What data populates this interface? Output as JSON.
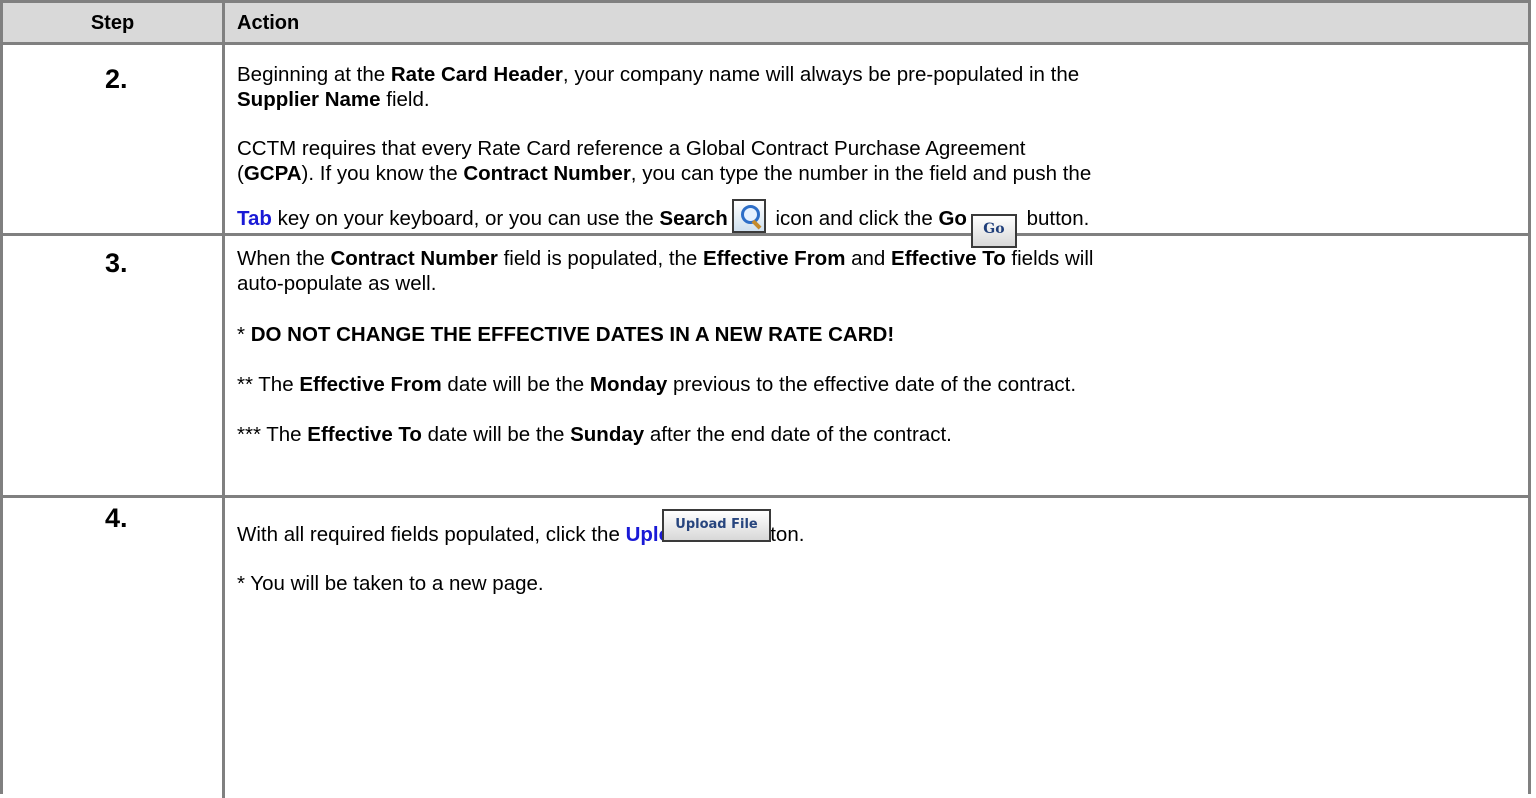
{
  "header": {
    "step": "Step",
    "action": "Action"
  },
  "rows": [
    {
      "step": "2.",
      "lines": {
        "l1a": "Beginning at the ",
        "l1b": "Rate Card Header",
        "l1c": ", your company name will always be pre-populated in the",
        "l2a": "Supplier Name",
        "l2b": " field.",
        "l3": "CCTM requires that every Rate Card reference a Global Contract Purchase Agreement",
        "l4a": "(",
        "l4b": "GCPA",
        "l4c": ").  If you know the ",
        "l4d": "Contract Number",
        "l4e": ", you can type the number in the field and push the",
        "l5a": "Tab",
        "l5b": " key on your keyboard, or you can use the ",
        "l5c": "Search",
        "l5d": " icon and click the ",
        "l5e": "Go",
        "l5f": " button."
      },
      "go_label": "Go"
    },
    {
      "step": "3.",
      "lines": {
        "l1a": "When the ",
        "l1b": "Contract Number",
        "l1c": " field is populated, the ",
        "l1d": "Effective From",
        "l1e": " and ",
        "l1f": "Effective To",
        "l1g": " fields will",
        "l2": "auto-populate as well.",
        "l3a": "* ",
        "l3b": "DO NOT CHANGE THE EFFECTIVE DATES IN A NEW RATE CARD!",
        "l4a": "** The ",
        "l4b": "Effective From",
        "l4c": " date will be the ",
        "l4d": "Monday",
        "l4e": " previous to the effective date of the contract.",
        "l5a": "*** The ",
        "l5b": "Effective To",
        "l5c": " date will be the ",
        "l5d": "Sunday",
        "l5e": " after the end date of the contract."
      }
    },
    {
      "step": "4.",
      "lines": {
        "l1a": "With all required fields populated, click the ",
        "l1b": "Upload File",
        "l1c": " button.",
        "l2": "* You will be taken to a new page."
      },
      "upload_label": "Upload File"
    }
  ],
  "icons": {
    "search": "magnifier-icon"
  }
}
